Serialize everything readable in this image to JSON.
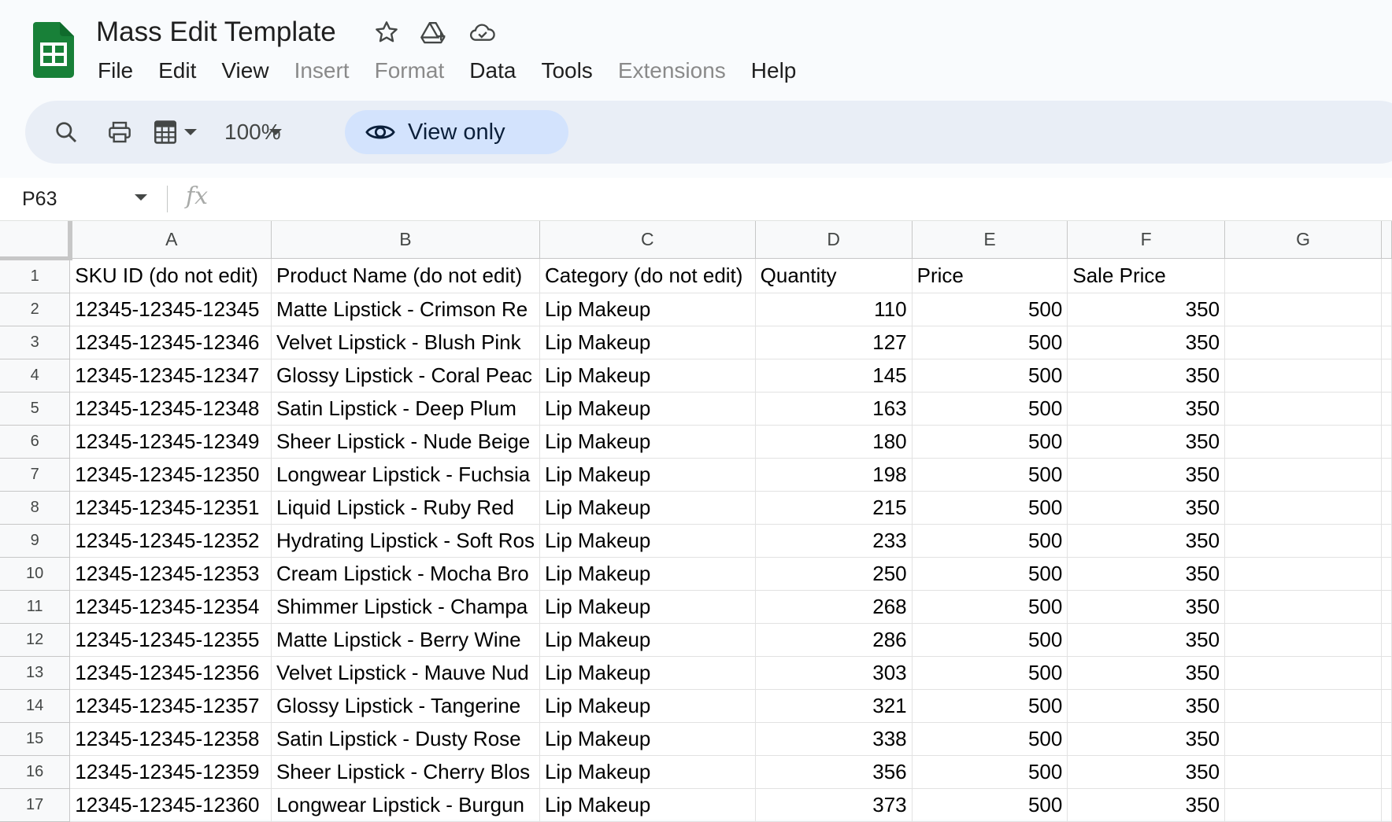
{
  "app": {
    "title": "Mass Edit Template",
    "brand_color": "#188038"
  },
  "menu": {
    "items": [
      {
        "label": "File",
        "enabled": true
      },
      {
        "label": "Edit",
        "enabled": true
      },
      {
        "label": "View",
        "enabled": true
      },
      {
        "label": "Insert",
        "enabled": false
      },
      {
        "label": "Format",
        "enabled": false
      },
      {
        "label": "Data",
        "enabled": true
      },
      {
        "label": "Tools",
        "enabled": true
      },
      {
        "label": "Extensions",
        "enabled": false
      },
      {
        "label": "Help",
        "enabled": true
      }
    ]
  },
  "toolbar": {
    "zoom": "100%",
    "view_only_label": "View only"
  },
  "formula_bar": {
    "name_box": "P63",
    "fx": "fx",
    "value": ""
  },
  "sheet": {
    "columns": [
      "A",
      "B",
      "C",
      "D",
      "E",
      "F",
      "G"
    ],
    "rows": [
      {
        "num": "1",
        "cells": [
          "SKU ID (do not edit)",
          "Product Name (do not edit)",
          "Category (do not edit)",
          "Quantity",
          "Price",
          "Sale Price",
          ""
        ]
      },
      {
        "num": "2",
        "cells": [
          "12345-12345-12345",
          "Matte Lipstick - Crimson Re",
          "Lip Makeup",
          "110",
          "500",
          "350",
          ""
        ]
      },
      {
        "num": "3",
        "cells": [
          "12345-12345-12346",
          "Velvet Lipstick - Blush Pink",
          "Lip Makeup",
          "127",
          "500",
          "350",
          ""
        ]
      },
      {
        "num": "4",
        "cells": [
          "12345-12345-12347",
          "Glossy Lipstick - Coral Peac",
          "Lip Makeup",
          "145",
          "500",
          "350",
          ""
        ]
      },
      {
        "num": "5",
        "cells": [
          "12345-12345-12348",
          "Satin Lipstick - Deep Plum",
          "Lip Makeup",
          "163",
          "500",
          "350",
          ""
        ]
      },
      {
        "num": "6",
        "cells": [
          "12345-12345-12349",
          "Sheer Lipstick - Nude Beige",
          "Lip Makeup",
          "180",
          "500",
          "350",
          ""
        ]
      },
      {
        "num": "7",
        "cells": [
          "12345-12345-12350",
          "Longwear Lipstick - Fuchsia",
          "Lip Makeup",
          "198",
          "500",
          "350",
          ""
        ]
      },
      {
        "num": "8",
        "cells": [
          "12345-12345-12351",
          "Liquid Lipstick - Ruby Red",
          "Lip Makeup",
          "215",
          "500",
          "350",
          ""
        ]
      },
      {
        "num": "9",
        "cells": [
          "12345-12345-12352",
          "Hydrating Lipstick - Soft Ros",
          "Lip Makeup",
          "233",
          "500",
          "350",
          ""
        ]
      },
      {
        "num": "10",
        "cells": [
          "12345-12345-12353",
          "Cream Lipstick - Mocha Bro",
          "Lip Makeup",
          "250",
          "500",
          "350",
          ""
        ]
      },
      {
        "num": "11",
        "cells": [
          "12345-12345-12354",
          "Shimmer Lipstick - Champa",
          "Lip Makeup",
          "268",
          "500",
          "350",
          ""
        ]
      },
      {
        "num": "12",
        "cells": [
          "12345-12345-12355",
          "Matte Lipstick - Berry Wine",
          "Lip Makeup",
          "286",
          "500",
          "350",
          ""
        ]
      },
      {
        "num": "13",
        "cells": [
          "12345-12345-12356",
          "Velvet Lipstick - Mauve Nud",
          "Lip Makeup",
          "303",
          "500",
          "350",
          ""
        ]
      },
      {
        "num": "14",
        "cells": [
          "12345-12345-12357",
          "Glossy Lipstick - Tangerine",
          "Lip Makeup",
          "321",
          "500",
          "350",
          ""
        ]
      },
      {
        "num": "15",
        "cells": [
          "12345-12345-12358",
          "Satin Lipstick - Dusty Rose",
          "Lip Makeup",
          "338",
          "500",
          "350",
          ""
        ]
      },
      {
        "num": "16",
        "cells": [
          "12345-12345-12359",
          "Sheer Lipstick - Cherry Blos",
          "Lip Makeup",
          "356",
          "500",
          "350",
          ""
        ]
      },
      {
        "num": "17",
        "cells": [
          "12345-12345-12360",
          "Longwear Lipstick - Burgun",
          "Lip Makeup",
          "373",
          "500",
          "350",
          ""
        ]
      }
    ]
  }
}
